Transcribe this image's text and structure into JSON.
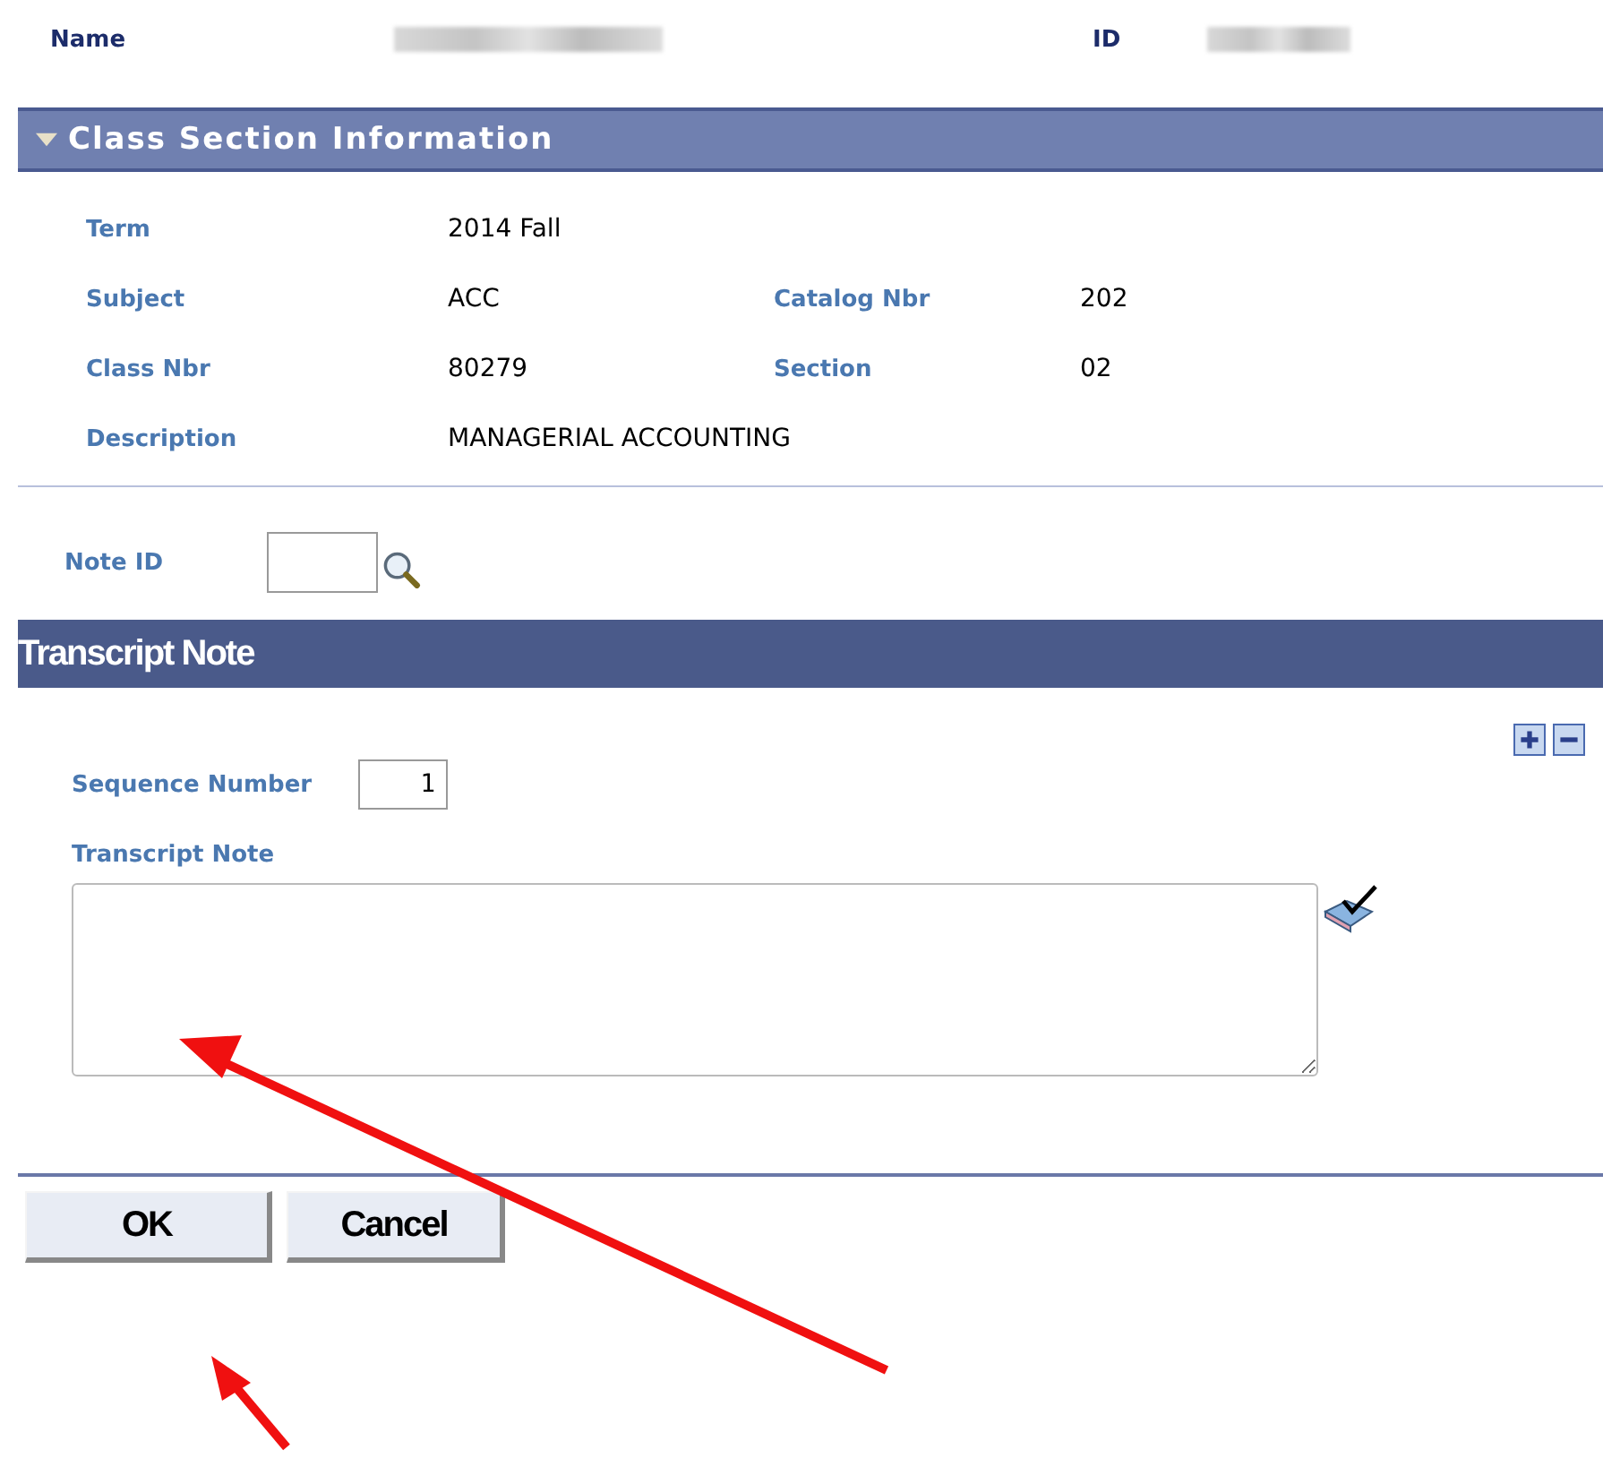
{
  "header": {
    "name_label": "Name",
    "id_label": "ID"
  },
  "class_section": {
    "title": "Class Section Information",
    "expanded": true,
    "rows": [
      {
        "pairs": [
          {
            "label": "Term",
            "value": "2014 Fall"
          }
        ]
      },
      {
        "pairs": [
          {
            "label": "Subject",
            "value": "ACC"
          },
          {
            "label": "Catalog Nbr",
            "value": "202"
          }
        ]
      },
      {
        "pairs": [
          {
            "label": "Class Nbr",
            "value": "80279"
          },
          {
            "label": "Section",
            "value": "02"
          }
        ]
      },
      {
        "pairs": [
          {
            "label": "Description",
            "value": "MANAGERIAL ACCOUNTING"
          }
        ]
      }
    ]
  },
  "note_id": {
    "label": "Note ID"
  },
  "transcript": {
    "title": "Transcript Note",
    "sequence_label": "Sequence Number",
    "sequence_value": "1",
    "note_label": "Transcript Note"
  },
  "buttons": [
    "OK",
    "Cancel"
  ]
}
